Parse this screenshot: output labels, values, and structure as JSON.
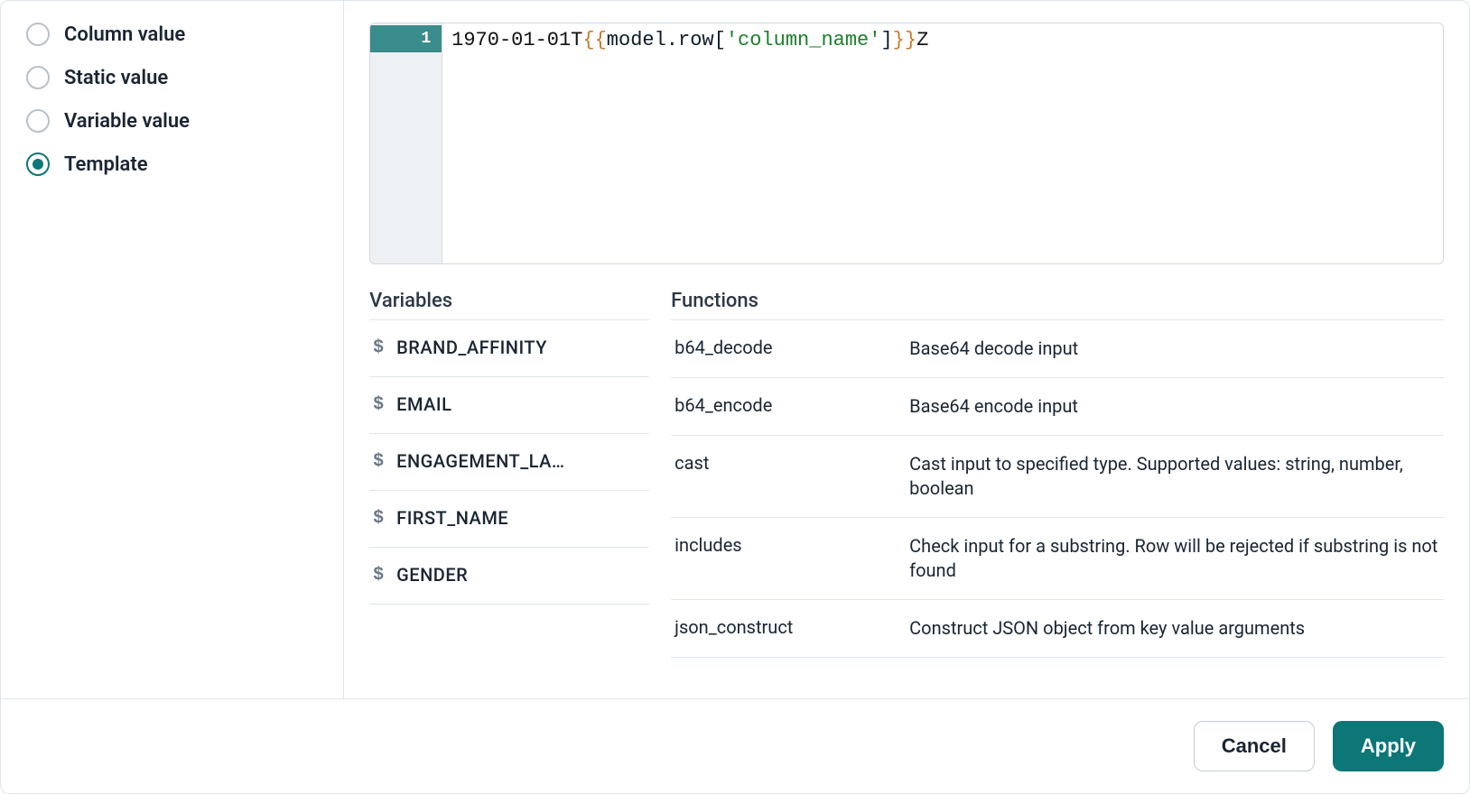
{
  "sidebar": {
    "options": [
      {
        "label": "Column value",
        "selected": false
      },
      {
        "label": "Static value",
        "selected": false
      },
      {
        "label": "Variable value",
        "selected": false
      },
      {
        "label": "Template",
        "selected": true
      }
    ]
  },
  "editor": {
    "line_number": "1",
    "tokens": {
      "prefix": "1970-01-01T",
      "open1": "{",
      "open2": "{",
      "obj": "model.row[",
      "str": "'column_name'",
      "close_br": "]",
      "close1": "}",
      "close2": "}",
      "suffix": "Z"
    }
  },
  "variables": {
    "heading": "Variables",
    "items": [
      {
        "name": "BRAND_AFFINITY"
      },
      {
        "name": "EMAIL"
      },
      {
        "name_display": "ENGAGEMENT_LA…",
        "name": "ENGAGEMENT_LA…"
      },
      {
        "name": "FIRST_NAME"
      },
      {
        "name": "GENDER"
      }
    ]
  },
  "functions": {
    "heading": "Functions",
    "items": [
      {
        "name": "b64_decode",
        "desc": "Base64 decode input"
      },
      {
        "name": "b64_encode",
        "desc": "Base64 encode input"
      },
      {
        "name": "cast",
        "desc": "Cast input to specified type. Supported values: string, number, boolean"
      },
      {
        "name": "includes",
        "desc": "Check input for a substring. Row will be rejected if substring is not found"
      },
      {
        "name": "json_construct",
        "desc": "Construct JSON object from key value arguments"
      }
    ]
  },
  "footer": {
    "cancel_label": "Cancel",
    "apply_label": "Apply"
  }
}
